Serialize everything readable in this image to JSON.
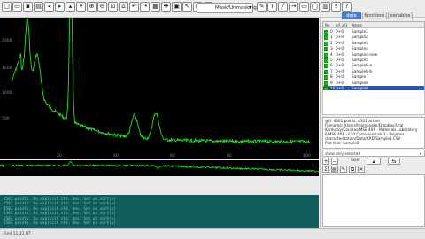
{
  "toolbar": {
    "icons": [
      "new-doc",
      "open-folder",
      "save",
      "print",
      "arrow-left",
      "arrow-right",
      "arrow-up",
      "arrow-down",
      "zoom-in",
      "zoom-out",
      "zoom-fit",
      "home",
      "undo",
      "redo",
      "grid",
      "marker",
      "lock",
      "cursor",
      "data-reader",
      "screen-reader",
      "draw",
      "text",
      "line",
      "arrow",
      "rect",
      "ellipse",
      "chart",
      "export",
      "help"
    ],
    "zoom_label": "Mask/Unmasking",
    "zoom_dropdown": "▾"
  },
  "plot": {
    "y_ticks": [
      "2000",
      "1500",
      "1000",
      "500"
    ],
    "x_ticks": [
      "20",
      "40",
      "60",
      "80",
      "100"
    ],
    "sub_ticks": [
      "1",
      "1"
    ]
  },
  "right_panel": {
    "tabs": [
      "data",
      "functions",
      "variables"
    ],
    "active_tab": "data",
    "columns": [
      "No",
      "vif. x/1",
      "Name"
    ],
    "rows": [
      {
        "no": "0",
        "x": "0+0",
        "name": "Sample1"
      },
      {
        "no": "1",
        "x": "0+0",
        "name": "Sample2"
      },
      {
        "no": "2",
        "x": "0+0",
        "name": "Sample3"
      },
      {
        "no": "3",
        "x": "0+0",
        "name": "Sample4"
      },
      {
        "no": "4",
        "x": "0+0",
        "name": "Sample4-new"
      },
      {
        "no": "5",
        "x": "0+0",
        "name": "Sample5"
      },
      {
        "no": "6",
        "x": "0+0",
        "name": "Sample6-a"
      },
      {
        "no": "7",
        "x": "0+0",
        "name": "Sample6-b"
      },
      {
        "no": "8",
        "x": "0+0",
        "name": "Sample7"
      },
      {
        "no": "9",
        "x": "0+0",
        "name": "Sample8"
      },
      {
        "no": "10",
        "x": "0+0",
        "name": "Sample8"
      }
    ],
    "selected_row": 10,
    "info_lines": [
      "@0: 4501 points, 4501 active.",
      "Filename: /Users/thomcooke/Dropbox/Ural",
      "Kentucky/Courses/MSE 409 - Materials Laboratory",
      "II/MSE 408 - F10 Corrosion/Lab 3 - Polymer",
      "characterization/Data/XRD/Sample8.CSV",
      "Plot title: Sample8"
    ],
    "show_selected": "show only selected",
    "controls": {
      "plus_label": "+",
      "minus_label": "−",
      "size_label": "Size",
      "arrow_label": "⇆"
    }
  },
  "console": {
    "lines": [
      "4501 points. No explicit std. dev. Set as sqrt(y)",
      "4501 points. No explicit std. dev. Set as sqrt(y)",
      "4501 points. No explicit std. dev. Set as sqrt(y)",
      "4501 points. No explicit std. dev. Set as sqrt(y)",
      "4501 points. No explicit std. dev. Set as sqrt(y)",
      "4501 points. No explicit std. dev. Set as sqrt(y)"
    ]
  },
  "status": {
    "text": "Find 11 11 BT"
  },
  "colors": {
    "trace": "#22e322",
    "plot_bg": "#000000",
    "console_bg": "#0f5d5d",
    "selected_row": "#2058c8",
    "active_tab": "#4b7fd6"
  }
}
